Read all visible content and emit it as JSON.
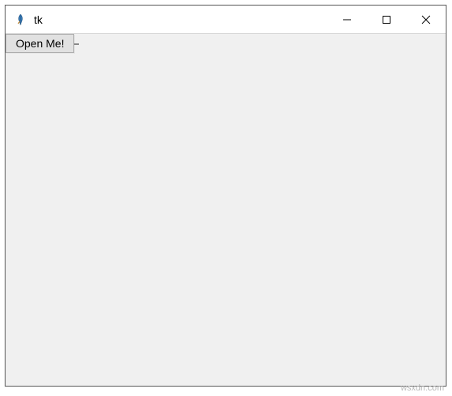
{
  "titlebar": {
    "title": "tk",
    "icon_name": "tk-feather-icon"
  },
  "window_controls": {
    "minimize": "minimize",
    "maximize": "maximize",
    "close": "close"
  },
  "content": {
    "open_button_label": "Open Me!"
  },
  "watermark": "wsxdn.com"
}
